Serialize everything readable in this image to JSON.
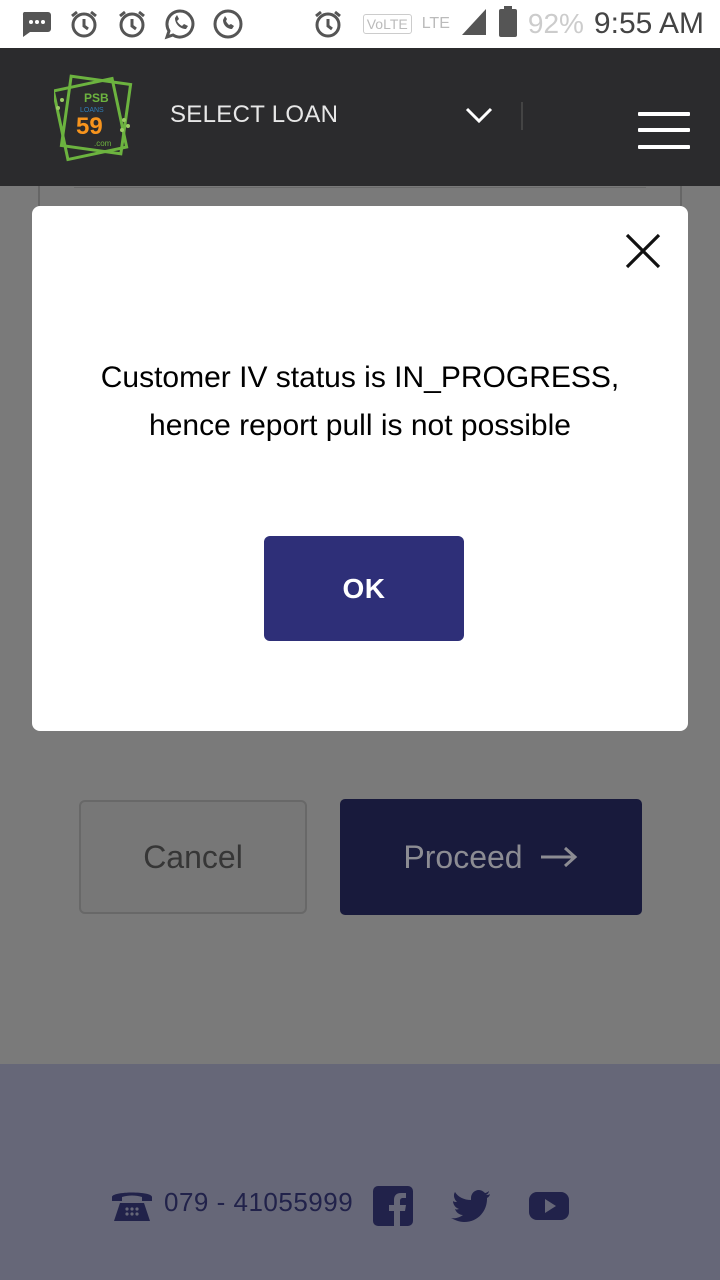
{
  "status_bar": {
    "time": "9:55 AM",
    "battery_percent": "92%",
    "network": "LTE",
    "volte": "VoLTE",
    "icons": [
      "message-icon",
      "alarm-icon",
      "alarm-icon",
      "whatsapp-icon",
      "phone-call-icon",
      "alarm-icon",
      "signal-icon",
      "battery-icon"
    ]
  },
  "header": {
    "logo_text_top": "PSB",
    "logo_text_mid": "LOANS",
    "logo_number": "59",
    "logo_suffix": ".com",
    "select_label": "SELECT LOAN",
    "dropdown_icon": "chevron-down-icon",
    "menu_icon": "hamburger-menu-icon"
  },
  "page": {
    "cancel_label": "Cancel",
    "proceed_label": "Proceed",
    "proceed_icon": "arrow-right-icon"
  },
  "modal": {
    "message": "Customer IV status is IN_PROGRESS, hence report pull is not possible",
    "ok_label": "OK",
    "close_icon": "close-icon"
  },
  "footer": {
    "phone": "079 - 41055999",
    "phone_icon": "telephone-icon",
    "social": [
      "facebook-icon",
      "twitter-icon",
      "youtube-icon"
    ]
  },
  "colors": {
    "header_bg": "#2b2b2d",
    "overlay_page": "#7a7a7a",
    "footer_bg": "#666778",
    "ok_button": "#2e2f78",
    "proceed_button": "#181a3c",
    "logo_green": "#6cb33f",
    "logo_orange": "#f7941d"
  }
}
